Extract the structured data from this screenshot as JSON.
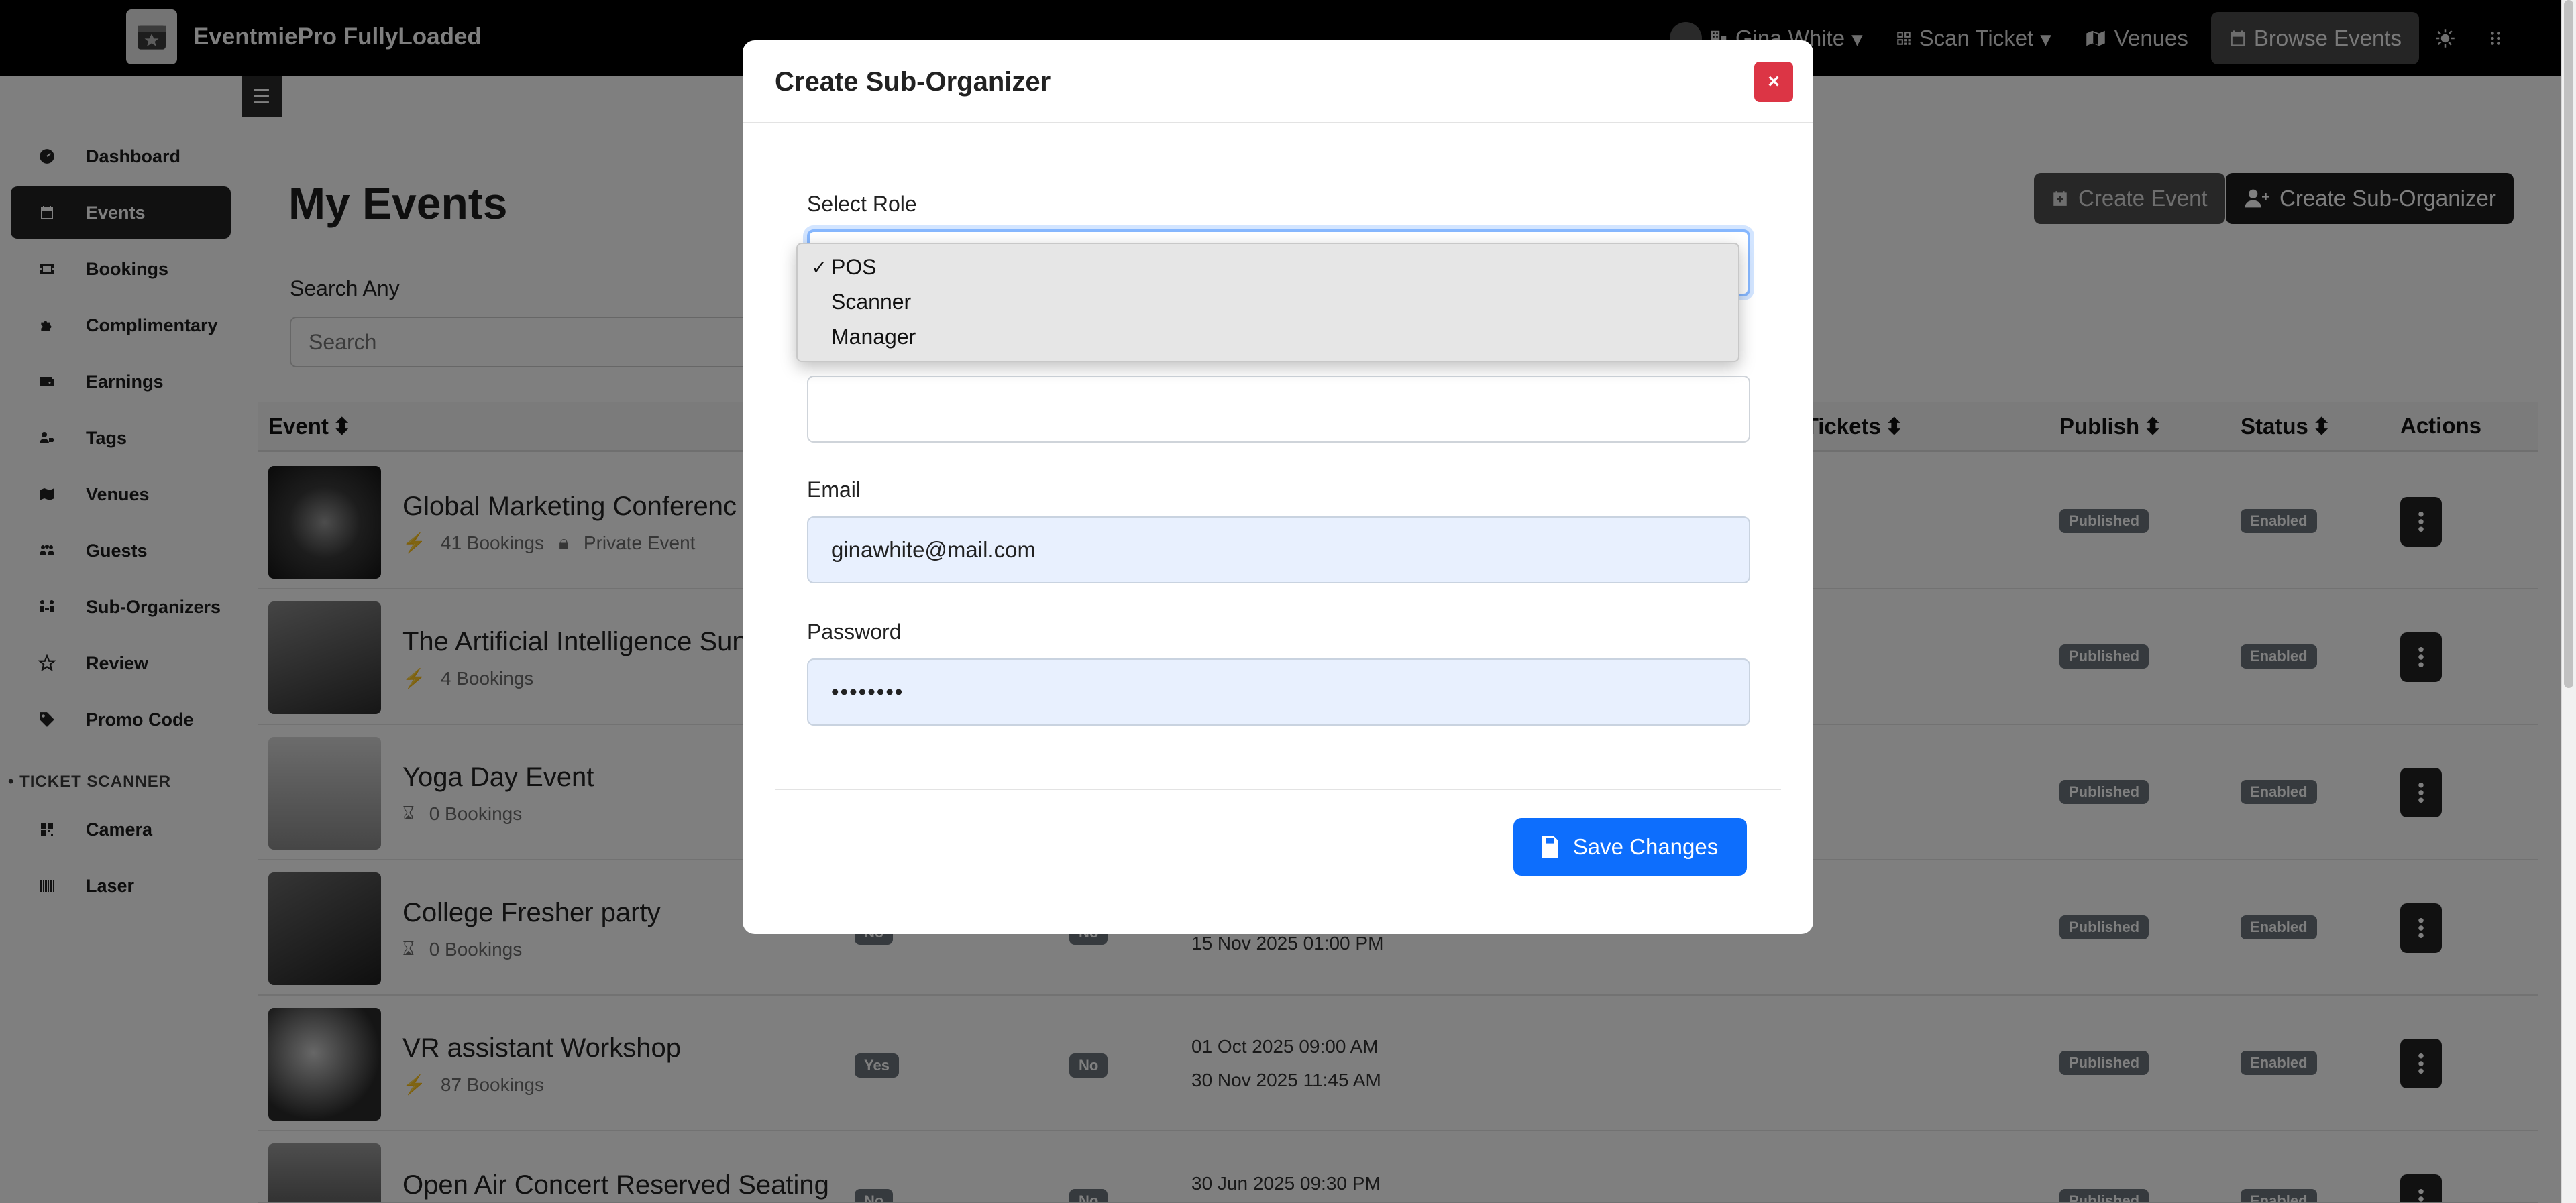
{
  "app": {
    "brand": "EventmiePro FullyLoaded",
    "nav": {
      "user": "Gina White",
      "scan_ticket": "Scan Ticket",
      "venues": "Venues",
      "browse_events": "Browse Events"
    }
  },
  "sidebar": {
    "items": [
      {
        "label": "Dashboard",
        "icon": "gauge-icon"
      },
      {
        "label": "Events",
        "icon": "calendar-icon",
        "active": true
      },
      {
        "label": "Bookings",
        "icon": "ticket-icon"
      },
      {
        "label": "Complimentary",
        "icon": "puzzle-icon"
      },
      {
        "label": "Earnings",
        "icon": "wallet-icon"
      },
      {
        "label": "Tags",
        "icon": "user-tag-icon"
      },
      {
        "label": "Venues",
        "icon": "map-icon"
      },
      {
        "label": "Guests",
        "icon": "people-icon"
      },
      {
        "label": "Sub-Organizers",
        "icon": "people-arrows-icon"
      },
      {
        "label": "Review",
        "icon": "star-icon"
      },
      {
        "label": "Promo Code",
        "icon": "tag-icon"
      }
    ],
    "scanner_section": "TICKET SCANNER",
    "scanner_items": [
      {
        "label": "Camera",
        "icon": "qrcode-icon"
      },
      {
        "label": "Laser",
        "icon": "barcode-icon"
      }
    ]
  },
  "main": {
    "title": "My Events",
    "create_event": "Create Event",
    "create_sub_organizer": "Create Sub-Organizer",
    "search_label": "Search Any",
    "search_placeholder": "Search",
    "columns": {
      "event": "Event",
      "tickets": "al Tickets",
      "publish": "Publish",
      "status": "Status",
      "actions": "Actions"
    },
    "rows": [
      {
        "title": "Global Marketing Conferenc",
        "bookings": "41 Bookings",
        "extra": "Private Event",
        "date1": "",
        "date2": "",
        "badge_a": "",
        "badge_b": "",
        "publish": "Published",
        "status": "Enabled"
      },
      {
        "title": "The Artificial Intelligence Sun",
        "bookings": "4 Bookings",
        "extra": "",
        "date1": "",
        "date2": "",
        "badge_a": "",
        "badge_b": "",
        "publish": "Published",
        "status": "Enabled"
      },
      {
        "title": "Yoga Day Event",
        "bookings": "0 Bookings",
        "extra": "",
        "date1": "",
        "date2": "",
        "badge_a": "",
        "badge_b": "",
        "publish": "Published",
        "status": "Enabled"
      },
      {
        "title": "College Fresher party",
        "bookings": "0 Bookings",
        "extra": "",
        "date1": "",
        "date2": "15 Nov 2025 01:00 PM",
        "badge_a": "No",
        "badge_b": "No",
        "publish": "Published",
        "status": "Enabled"
      },
      {
        "title": "VR assistant Workshop",
        "bookings": "87 Bookings",
        "extra": "",
        "date1": "01 Oct 2025 09:00 AM",
        "date2": "30 Nov 2025 11:45 AM",
        "badge_a": "Yes",
        "badge_b": "No",
        "publish": "Published",
        "status": "Enabled"
      },
      {
        "title": "Open Air Concert Reserved Seating",
        "bookings": "",
        "extra": "",
        "date1": "30 Jun 2025 09:30 PM",
        "date2": "",
        "badge_a": "No",
        "badge_b": "No",
        "publish": "Published",
        "status": "Enabled"
      }
    ]
  },
  "modal": {
    "title": "Create Sub-Organizer",
    "close": "×",
    "role_label": "Select Role",
    "role_options": [
      {
        "label": "POS",
        "selected": true
      },
      {
        "label": "Scanner",
        "selected": false
      },
      {
        "label": "Manager",
        "selected": false
      }
    ],
    "name_value": "",
    "email_label": "Email",
    "email_value": "ginawhite@mail.com",
    "password_label": "Password",
    "password_value": "••••••••",
    "save": "Save Changes"
  },
  "colors": {
    "primary": "#0d6efd",
    "danger": "#dc3545",
    "dark": "#222222",
    "badge": "#6c757d",
    "autofill": "#e8f0fe"
  }
}
